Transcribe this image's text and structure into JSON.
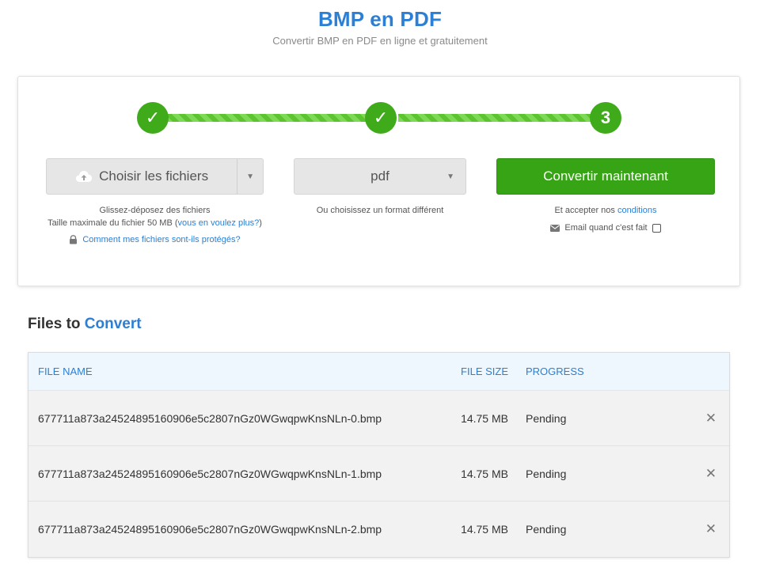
{
  "header": {
    "title": "BMP en PDF",
    "subtitle": "Convertir BMP en PDF en ligne et gratuitement"
  },
  "stepper": {
    "step3_label": "3",
    "done_glyph": "✓"
  },
  "upload": {
    "choose_label": "Choisir les fichiers",
    "drag_text": "Glissez-déposez des fichiers",
    "max_size_text": "Taille maximale du fichier 50 MB (",
    "more_link": "vous en voulez plus?",
    "max_size_close": ")",
    "secure_link": "Comment mes fichiers sont-ils protégés?"
  },
  "format": {
    "selected": "pdf",
    "hint": "Ou choisissez un format différent"
  },
  "convert": {
    "button_label": "Convertir maintenant",
    "terms_prefix": "Et accepter nos ",
    "terms_link": "conditions",
    "email_label": "Email quand c'est fait"
  },
  "files_section": {
    "title_part1": "Files to ",
    "title_part2": "Convert",
    "columns": {
      "name": "FILE NAME",
      "size": "FILE SIZE",
      "progress": "PROGRESS"
    },
    "rows": [
      {
        "name": "677711a873a24524895160906e5c2807nGz0WGwqpwKnsNLn-0.bmp",
        "size": "14.75 MB",
        "progress": "Pending"
      },
      {
        "name": "677711a873a24524895160906e5c2807nGz0WGwqpwKnsNLn-1.bmp",
        "size": "14.75 MB",
        "progress": "Pending"
      },
      {
        "name": "677711a873a24524895160906e5c2807nGz0WGwqpwKnsNLn-2.bmp",
        "size": "14.75 MB",
        "progress": "Pending"
      }
    ],
    "remove_glyph": "✕"
  },
  "colors": {
    "accent": "#2b7fd4",
    "success": "#36a415"
  }
}
